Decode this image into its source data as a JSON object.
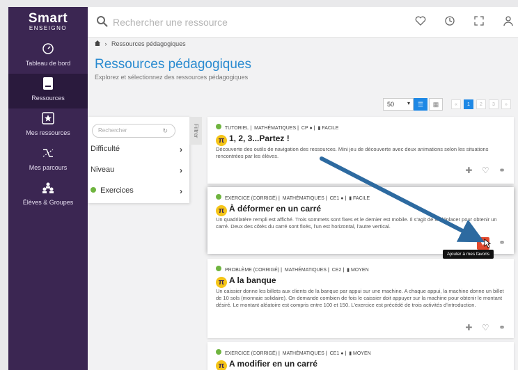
{
  "app": {
    "logo_main": "Smart",
    "logo_sub": "ENSEIGNO"
  },
  "sidebar": {
    "items": [
      {
        "label": "Tableau de bord",
        "icon": "gauge-icon"
      },
      {
        "label": "Ressources",
        "icon": "book-icon",
        "active": true
      },
      {
        "label": "Mes ressources",
        "icon": "star-box-icon"
      },
      {
        "label": "Mes parcours",
        "icon": "route-icon"
      },
      {
        "label": "Élèves & Groupes",
        "icon": "users-icon"
      }
    ]
  },
  "topbar": {
    "search_placeholder": "Rechercher une ressource",
    "icons": [
      "heart-icon",
      "history-icon",
      "fullscreen-icon",
      "user-icon"
    ]
  },
  "breadcrumb": {
    "current": "Ressources pédagogiques"
  },
  "page": {
    "title": "Ressources pédagogiques",
    "subtitle": "Explorez et sélectionnez des ressources pédagogiques"
  },
  "pagination": {
    "per_page": "50",
    "pages": [
      "«",
      "1",
      "2",
      "3",
      "»"
    ],
    "current": "1"
  },
  "filter": {
    "search_placeholder": "Rechercher",
    "tab_label": "Filtrer",
    "rows": [
      {
        "label": "Difficulté"
      },
      {
        "label": "Niveau"
      },
      {
        "label": "Exercices",
        "dot": true
      }
    ]
  },
  "cards": [
    {
      "type": "TUTORIEL",
      "subject": "MATHÉMATIQUES",
      "level": "CP",
      "difficulty": "FACILE",
      "title": "1, 2, 3...Partez !",
      "description": "Découverte des outils de navigation des ressources. Mini jeu de découverte avec deux animations selon les situations rencontrées par les élèves."
    },
    {
      "type": "EXERCICE (CORRIGÉ)",
      "subject": "MATHÉMATIQUES",
      "level": "CE1",
      "difficulty": "FACILE",
      "title": "À déformer en un carré",
      "description": "Un quadrilatère rempli est affiché. Trois sommets sont fixes et le dernier est mobile. Il s'agit de le déplacer pour obtenir un carré. Deux des côtés du carré sont fixés, l'un est horizontal, l'autre vertical."
    },
    {
      "type": "PROBLÈME (CORRIGÉ)",
      "subject": "MATHÉMATIQUES",
      "level": "CE2",
      "difficulty": "MOYEN",
      "title": "A la banque",
      "description": "Un caissier donne les billets aux clients de la banque par appui sur une machine. A chaque appui, la machine donne un billet de 10 sols (monnaie solidaire). On demande combien de fois le caissier doit appuyer sur la machine pour obtenir le montant désiré. Le montant aléatoire est compris entre 100 et 150. L'exercice est précédé de trois activités d'introduction."
    },
    {
      "type": "EXERCICE (CORRIGÉ)",
      "subject": "MATHÉMATIQUES",
      "level": "CE1",
      "difficulty": "MOYEN",
      "title": "A modifier en un carré",
      "description": ""
    }
  ],
  "tooltip": "Ajouter à mes favoris",
  "colors": {
    "sidebar": "#3b2652",
    "accent": "#2a8bd0",
    "favorite": "#e2492e",
    "arrow": "#2d6aa0"
  }
}
